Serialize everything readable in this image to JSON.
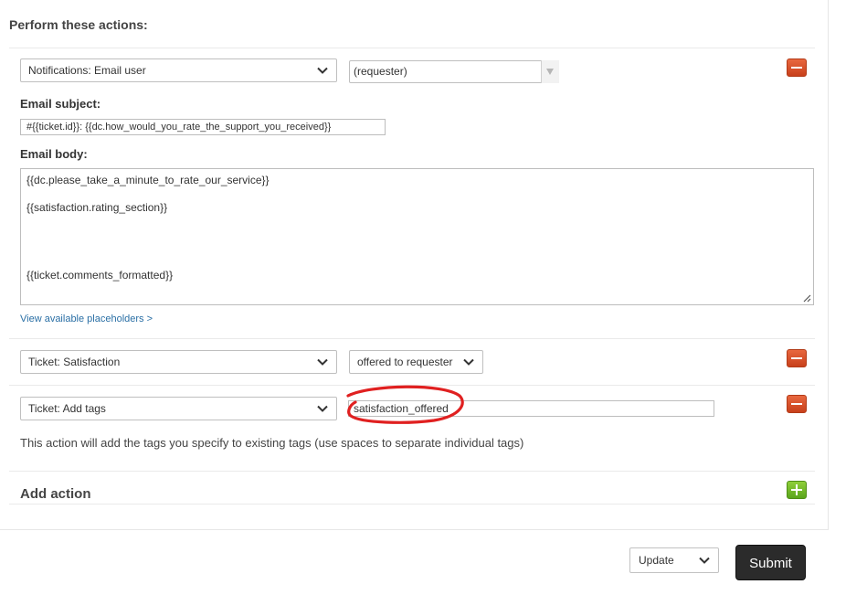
{
  "title": "Perform these actions:",
  "actions": {
    "email": {
      "type_label": "Notifications: Email user",
      "recipient_value": "(requester)",
      "subject_label": "Email subject:",
      "subject_value": "#{{ticket.id}}: {{dc.how_would_you_rate_the_support_you_received}}",
      "body_label": "Email body:",
      "body_lines": [
        "{{dc.please_take_a_minute_to_rate_our_service}}",
        "{{satisfaction.rating_section}}",
        "{{ticket.comments_formatted}}"
      ],
      "placeholders_link": "View available placeholders >"
    },
    "satisfaction": {
      "type_label": "Ticket: Satisfaction",
      "value": "offered to requester"
    },
    "tags": {
      "type_label": "Ticket: Add tags",
      "value": "satisfaction_offered",
      "help": "This action will add the tags you specify to existing tags (use spaces to separate individual tags)"
    }
  },
  "add_action_label": "Add action",
  "footer": {
    "update_label": "Update",
    "submit_label": "Submit"
  },
  "colors": {
    "remove_button": "#d9532c",
    "add_button": "#6bb52a",
    "submit_bg": "#2b2b2b",
    "annotation": "#e02020",
    "link": "#2a6fa5"
  },
  "icons": [
    "chevron-down-icon",
    "minus-icon",
    "plus-icon",
    "resize-handle-icon"
  ]
}
